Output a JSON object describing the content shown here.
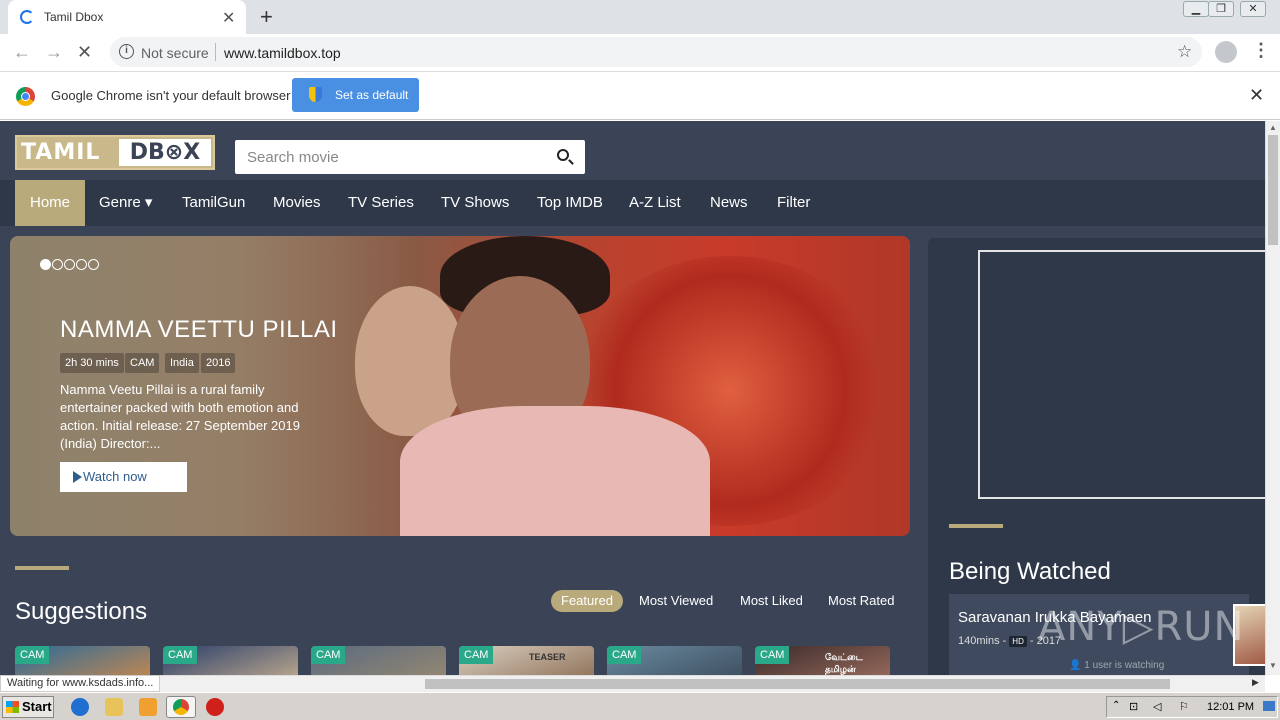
{
  "browser": {
    "tab_title": "Tamil Dbox",
    "security_label": "Not secure",
    "url": "www.tamildbox.top",
    "infobar_text": "Google Chrome isn't your default browser",
    "set_default_label": "Set as default",
    "status_text": "Waiting for www.ksdads.info..."
  },
  "site": {
    "logo_left": "TAMIL",
    "logo_right": "DB⊗X",
    "search_placeholder": "Search movie",
    "nav": [
      "Home",
      "Genre ▾",
      "TamilGun",
      "Movies",
      "TV Series",
      "TV Shows",
      "Top IMDB",
      "A-Z List",
      "News",
      "Filter"
    ]
  },
  "hero": {
    "title": "NAMMA VEETTU PILLAI",
    "badges": [
      "2h 30 mins",
      "CAM",
      "India",
      "2016"
    ],
    "description": "Namma Veetu Pillai is a rural family entertainer packed with both emotion and action. Initial release: 27 September 2019 (India) Director:...",
    "watch_label": "Watch now",
    "active_slide": 1,
    "slide_count": 5
  },
  "suggestions": {
    "title": "Suggestions",
    "filters": [
      "Featured",
      "Most Viewed",
      "Most Liked",
      "Most Rated"
    ],
    "posters": [
      {
        "badge": "CAM",
        "colors": [
          "#2a6a9a",
          "#d08a4a"
        ]
      },
      {
        "badge": "CAM",
        "colors": [
          "#2a3e6a",
          "#c8b090"
        ]
      },
      {
        "badge": "CAM",
        "colors": [
          "#5a6a80",
          "#9a8a70"
        ]
      },
      {
        "badge": "CAM",
        "colors": [
          "#d8cfc0",
          "#8a6a50"
        ],
        "overlay": "TEASER"
      },
      {
        "badge": "CAM",
        "colors": [
          "#6a8aa0",
          "#3a4a5a"
        ]
      },
      {
        "badge": "CAM",
        "colors": [
          "#3a2a2a",
          "#a07060"
        ],
        "overlay": "வேட்டை தமிழன்"
      }
    ]
  },
  "sidebar": {
    "title": "Being Watched",
    "card_title": "Saravanan Irukka Bayamaen",
    "card_duration": "140mins -",
    "card_quality": "HD",
    "card_year": "- 2017",
    "card_viewers": "👤 1 user is watching"
  },
  "watermark": "ANY▷RUN",
  "taskbar": {
    "start_label": "Start",
    "clock": "12:01 PM"
  }
}
